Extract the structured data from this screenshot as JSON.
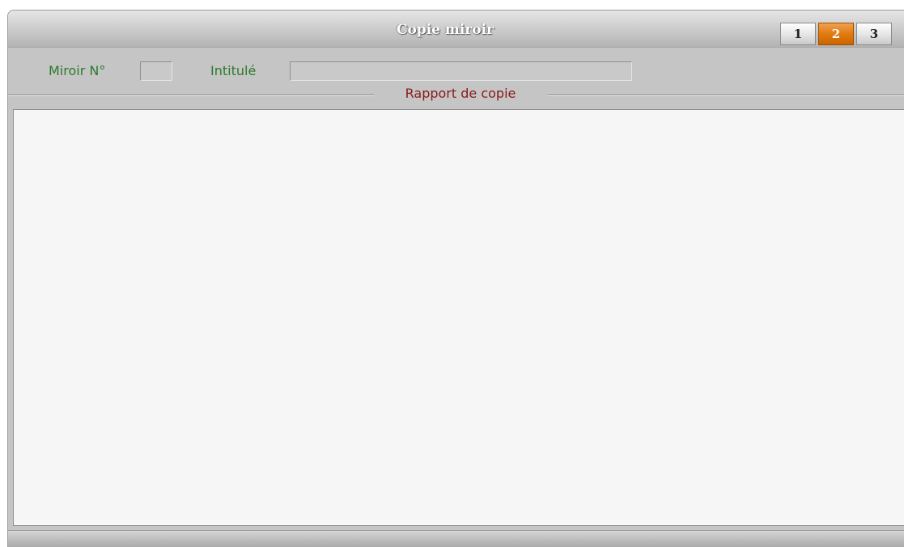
{
  "window": {
    "title": "Copie miroir"
  },
  "pages": [
    {
      "label": "1",
      "active": false
    },
    {
      "label": "2",
      "active": true
    },
    {
      "label": "3",
      "active": false
    }
  ],
  "fields": {
    "miroir_label": "Miroir N°",
    "miroir_value": "",
    "intitule_label": "Intitulé",
    "intitule_value": ""
  },
  "section": {
    "title": "Rapport de copie"
  },
  "report": {
    "content": ""
  },
  "colors": {
    "label_green": "#2c7a2c",
    "section_red": "#8b1a1a",
    "active_tab_orange": "#e17a10"
  }
}
